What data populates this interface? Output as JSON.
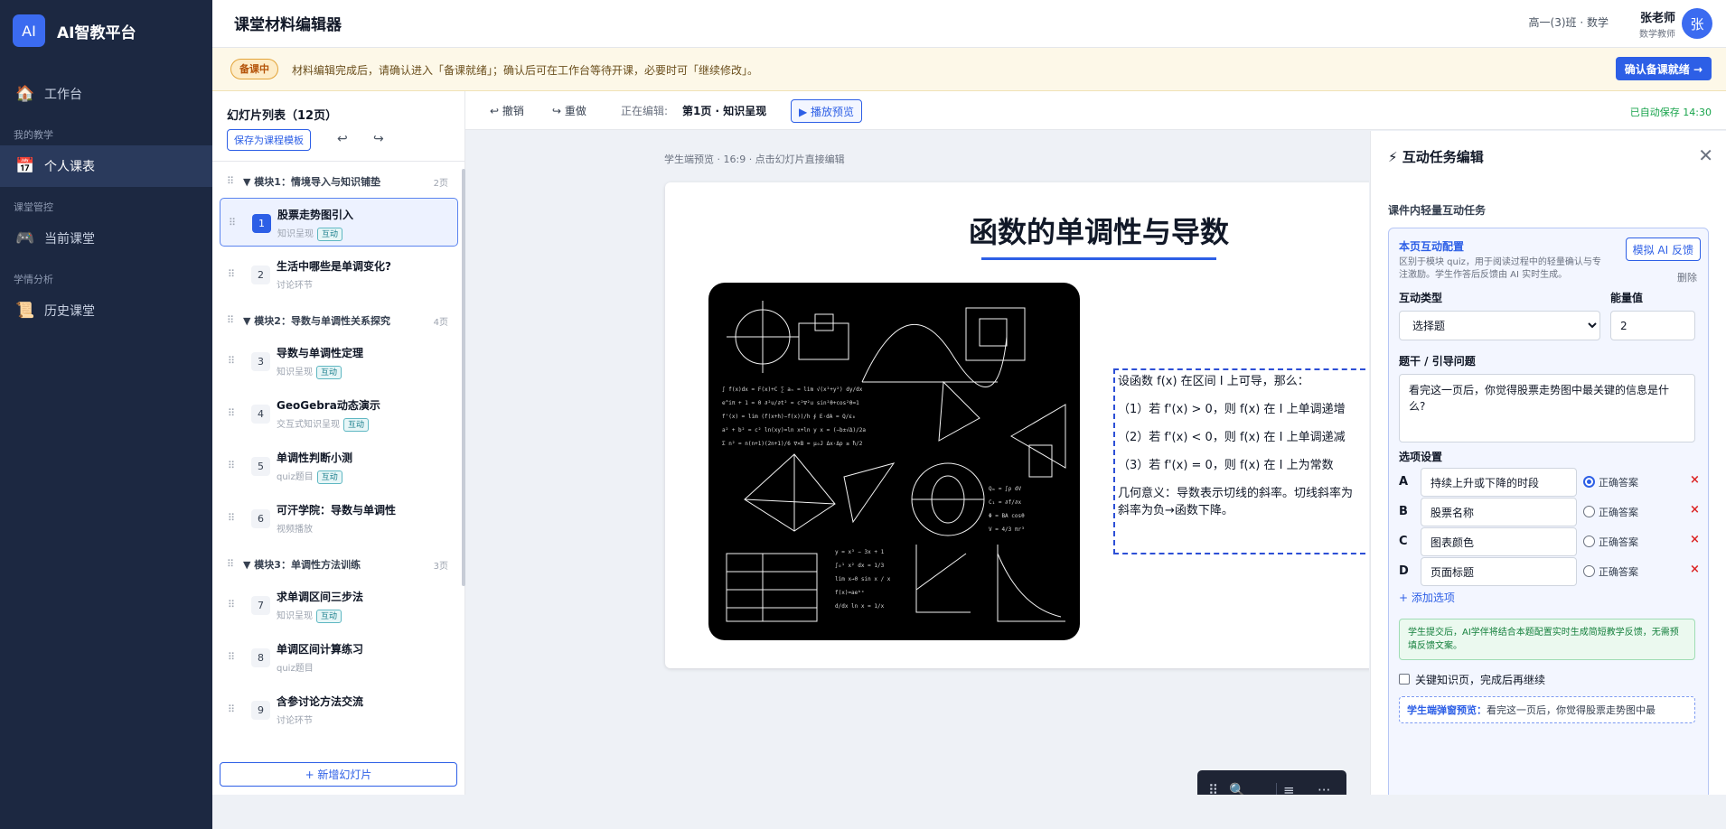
{
  "brand": {
    "logo": "AI",
    "name": "AI智教平台"
  },
  "nav": {
    "workbench": "工作台",
    "section_teaching": "我的教学",
    "personal": "个人课表",
    "section_manage": "课堂管控",
    "current": "当前课堂",
    "section_analysis": "学情分析",
    "history": "历史课堂"
  },
  "header": {
    "title": "课堂材料编辑器",
    "class_info": "高一(3)班 · 数学",
    "user_name": "张老师",
    "user_role": "数学教师",
    "avatar": "张"
  },
  "banner": {
    "badge": "备课中",
    "text": "材料编辑完成后，请确认进入「备课就绪」；确认后可在工作台等待开课，必要时可「继续修改」。",
    "button": "确认备课就绪 →"
  },
  "slide_panel": {
    "title": "幻灯片列表（12页）",
    "save_template": "保存为课程模板",
    "add_slide": "+ 新增幻灯片",
    "interact_tag": "互动",
    "modules": [
      {
        "title": "▼ 模块1：情境导入与知识铺垫",
        "count": "2页"
      },
      {
        "title": "▼ 模块2：导数与单调性关系探究",
        "count": "4页"
      },
      {
        "title": "▼ 模块3：单调性方法训练",
        "count": "3页"
      }
    ],
    "slides": [
      {
        "num": "1",
        "title": "股票走势图引入",
        "type": "知识呈现"
      },
      {
        "num": "2",
        "title": "生活中哪些是单调变化?",
        "type": "讨论环节"
      },
      {
        "num": "3",
        "title": "导数与单调性定理",
        "type": "知识呈现"
      },
      {
        "num": "4",
        "title": "GeoGebra动态演示",
        "type": "交互式知识呈现"
      },
      {
        "num": "5",
        "title": "单调性判断小测",
        "type": "quiz题目"
      },
      {
        "num": "6",
        "title": "可汗学院：导数与单调性",
        "type": "视频播放"
      },
      {
        "num": "7",
        "title": "求单调区间三步法",
        "type": "知识呈现"
      },
      {
        "num": "8",
        "title": "单调区间计算练习",
        "type": "quiz题目"
      },
      {
        "num": "9",
        "title": "含参讨论方法交流",
        "type": "讨论环节"
      }
    ]
  },
  "toolbar": {
    "undo": "↩ 撤销",
    "redo": "↪ 重做",
    "editing_label": "正在编辑:",
    "editing_page": "第1页 · 知识呈现",
    "play": "▶ 播放预览",
    "autosave": "已自动保存 14:30"
  },
  "canvas": {
    "note": "学生端预览 · 16:9 · 点击幻灯片直接编辑",
    "slide_title": "函数的单调性与导数",
    "lines": [
      "设函数 f(x) 在区间 I 上可导，那么：",
      "（1）若 f'(x) > 0，则 f(x) 在 I 上单调递增",
      "（2）若 f'(x) < 0，则 f(x) 在 I 上单调递减",
      "（3）若 f'(x) = 0，则 f(x) 在 I 上为常数",
      "几何意义：导数表示切线的斜率。切线斜率为",
      "斜率为负→函数下降。"
    ]
  },
  "interaction": {
    "title": "⚡ 互动任务编辑",
    "subtitle": "课件内轻量互动任务",
    "card_title": "本页互动配置",
    "card_desc": "区别于模块 quiz，用于阅读过程中的轻量确认与专注激励。学生作答后反馈由 AI 实时生成。",
    "ai_button": "模拟 AI 反馈",
    "delete": "删除",
    "type_label": "互动类型",
    "type_value": "选择题",
    "energy_label": "能量值",
    "energy_value": "2",
    "stem_label": "题干 / 引导问题",
    "stem_value": "看完这一页后，你觉得股票走势图中最关键的信息是什么?",
    "options_label": "选项设置",
    "correct_label": "正确答案",
    "options": [
      {
        "letter": "A",
        "text": "持续上升或下降的时段"
      },
      {
        "letter": "B",
        "text": "股票名称"
      },
      {
        "letter": "C",
        "text": "图表颜色"
      },
      {
        "letter": "D",
        "text": "页面标题"
      }
    ],
    "add_option": "+ 添加选项",
    "hint": "学生提交后，AI学伴将结合本题配置实时生成简短教学反馈，无需预填反馈文案。",
    "key_page": "关键知识页，完成后再继续",
    "preview_label": "学生端弹窗预览：",
    "preview_text": "看完这一页后，你觉得股票走势图中最"
  },
  "colors": {
    "accent": "#2d5fe6",
    "sidebar": "#1c2841",
    "tag": "#1b7f8c",
    "success": "#16a34a",
    "danger": "#dc2626"
  }
}
